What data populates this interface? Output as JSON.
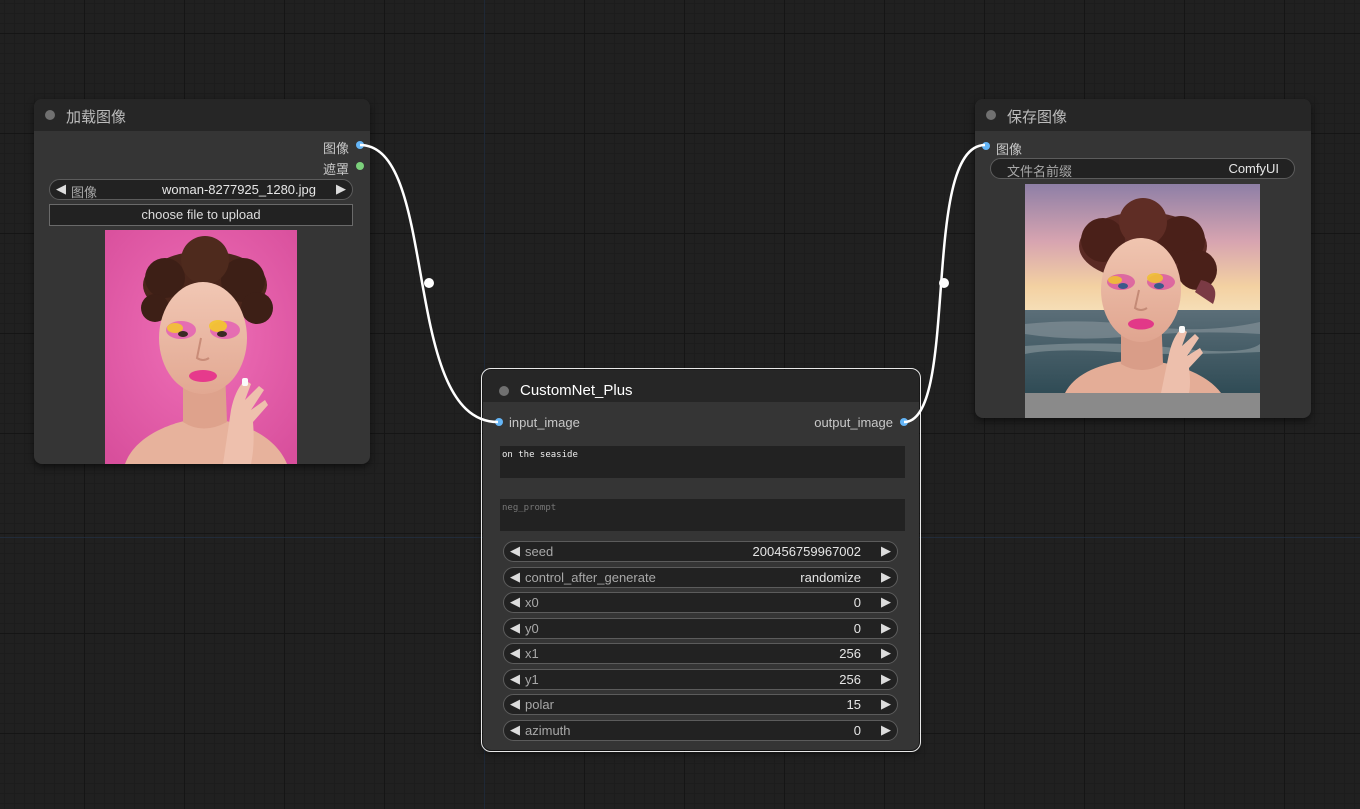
{
  "load_node": {
    "title": "加载图像",
    "outputs": [
      "图像",
      "遮罩"
    ],
    "image_widget": {
      "label": "图像",
      "value": "woman-8277925_1280.jpg"
    },
    "upload_button": "choose file to upload",
    "preview": "woman-portrait-pink"
  },
  "custom_node": {
    "title": "CustomNet_Plus",
    "input": "input_image",
    "output": "output_image",
    "prompt": "on the seaside",
    "neg_prompt_placeholder": "neg_prompt",
    "widgets": [
      {
        "label": "seed",
        "value": "200456759967002"
      },
      {
        "label": "control_after_generate",
        "value": "randomize"
      },
      {
        "label": "x0",
        "value": "0"
      },
      {
        "label": "y0",
        "value": "0"
      },
      {
        "label": "x1",
        "value": "256"
      },
      {
        "label": "y1",
        "value": "256"
      },
      {
        "label": "polar",
        "value": "15"
      },
      {
        "label": "azimuth",
        "value": "0"
      }
    ]
  },
  "save_node": {
    "title": "保存图像",
    "input": "图像",
    "prefix_widget": {
      "label": "文件名前缀",
      "value": "ComfyUI"
    },
    "preview": "woman-portrait-seaside"
  },
  "colors": {
    "canvas": "#202020",
    "node_body": "#353535",
    "node_title": "#262626",
    "image_slot": "#64b5f6",
    "mask_slot": "#7bd07b",
    "wire": "#ffffff"
  }
}
